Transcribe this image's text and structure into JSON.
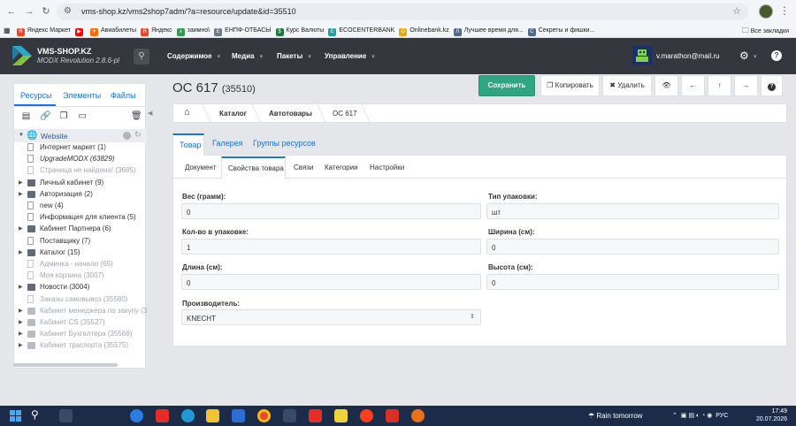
{
  "browser": {
    "url": "vms-shop.kz/vms2shop7adm/?a=resource/update&id=35510",
    "bookmarks": [
      {
        "label": "Яндекс Маркет",
        "color": "#fc3f1d",
        "glyph": "Я"
      },
      {
        "label": "",
        "color": "#ff0000",
        "glyph": "▶"
      },
      {
        "label": "Авиабилеты",
        "color": "#ff6a00",
        "glyph": "✈"
      },
      {
        "label": "Яндекс",
        "color": "#fc3f1d",
        "glyph": "Я"
      },
      {
        "label": "заимно\\",
        "color": "#2e9b4f",
        "glyph": "з"
      },
      {
        "label": "ЕНПФ-ОТБАСЫ",
        "color": "#6a7a8a",
        "glyph": "Е"
      },
      {
        "label": "Курс Валюты",
        "color": "#1f7a3d",
        "glyph": "$"
      },
      {
        "label": "ECOCENTERBANK",
        "color": "#1aa3a3",
        "glyph": "E"
      },
      {
        "label": "Onlinebank.kz",
        "color": "#e8a50d",
        "glyph": "O"
      },
      {
        "label": "Лучшее время для...",
        "color": "#4b6b8f",
        "glyph": "Л"
      },
      {
        "label": "Секреты и фишки...",
        "color": "#4b6b8f",
        "glyph": "С"
      }
    ],
    "all_bookmarks": "Все закладки"
  },
  "header": {
    "site_name": "VMS-SHOP.KZ",
    "version": "MODX Revolution 2.8.6-pl",
    "menu": [
      "Содержимое",
      "Медиа",
      "Пакеты",
      "Управление"
    ],
    "user": "v.marathon@mail.ru"
  },
  "left": {
    "tabs": [
      "Ресурсы",
      "Элементы",
      "Файлы"
    ],
    "root": "Website",
    "tree": [
      {
        "label": "Интернет маркет (1)",
        "icon": "page",
        "arrow": false,
        "style": ""
      },
      {
        "label": "UpgradeMODX (63829)",
        "icon": "page",
        "arrow": false,
        "style": "ital"
      },
      {
        "label": "Страница не найдена! (3685)",
        "icon": "pageg",
        "arrow": false,
        "style": "gray"
      },
      {
        "label": "Личный кабинет (9)",
        "icon": "folder",
        "arrow": true,
        "style": ""
      },
      {
        "label": "Авторизация (2)",
        "icon": "folder",
        "arrow": true,
        "style": ""
      },
      {
        "label": "new (4)",
        "icon": "page",
        "arrow": false,
        "style": ""
      },
      {
        "label": "Информация для клиента (5)",
        "icon": "page",
        "arrow": false,
        "style": ""
      },
      {
        "label": "Кабинет Партнера (6)",
        "icon": "folder",
        "arrow": true,
        "style": ""
      },
      {
        "label": "Поставщику (7)",
        "icon": "page",
        "arrow": false,
        "style": ""
      },
      {
        "label": "Каталог (15)",
        "icon": "folder",
        "arrow": true,
        "style": ""
      },
      {
        "label": "Админка - начало (65)",
        "icon": "pageg",
        "arrow": false,
        "style": "gray"
      },
      {
        "label": "Моя корзина (3007)",
        "icon": "pageg",
        "arrow": false,
        "style": "gray"
      },
      {
        "label": "Новости (3004)",
        "icon": "folder",
        "arrow": true,
        "style": ""
      },
      {
        "label": "Заказы самовывоз (35580)",
        "icon": "pageg",
        "arrow": false,
        "style": "gray"
      },
      {
        "label": "Кабинет менеджера по закупу (3557",
        "icon": "folderg",
        "arrow": true,
        "style": "gray"
      },
      {
        "label": "Кабинет CS (35527)",
        "icon": "folderg",
        "arrow": true,
        "style": "gray"
      },
      {
        "label": "Кабинет Бухгалтера (35566)",
        "icon": "folderg",
        "arrow": true,
        "style": "gray"
      },
      {
        "label": "Кабинет траспорта (35575)",
        "icon": "folderg",
        "arrow": true,
        "style": "gray"
      }
    ]
  },
  "main": {
    "title": "OC 617",
    "id": "(35510)",
    "buttons": {
      "save": "Сохранить",
      "copy": "Копировать",
      "delete": "Удалить"
    },
    "breadcrumb": [
      "Каталог",
      "Автотовары",
      "OC 617"
    ],
    "tabs": [
      "Товар",
      "Галерея",
      "Группы ресурсов"
    ],
    "subtabs": [
      "Документ",
      "Свойства товара",
      "Связи",
      "Категории",
      "Настройки"
    ],
    "fields": {
      "weight": {
        "label": "Вес (грамм):",
        "value": "0"
      },
      "pack_type": {
        "label": "Тип упаковки:",
        "value": "шт"
      },
      "qty": {
        "label": "Кол-во в упаковке:",
        "value": "1"
      },
      "width": {
        "label": "Ширина (см):",
        "value": "0"
      },
      "length": {
        "label": "Длина (см):",
        "value": "0"
      },
      "height": {
        "label": "Высота (см):",
        "value": "0"
      },
      "maker": {
        "label": "Производитель:",
        "value": "KNECHT"
      }
    }
  },
  "taskbar": {
    "weather": "Rain tomorrow",
    "lang": "РУС",
    "time": "17:49",
    "date": "20.07.2026"
  },
  "colors": {
    "accent": "#1a73e8",
    "save": "#2fa581",
    "header": "#34383e"
  }
}
